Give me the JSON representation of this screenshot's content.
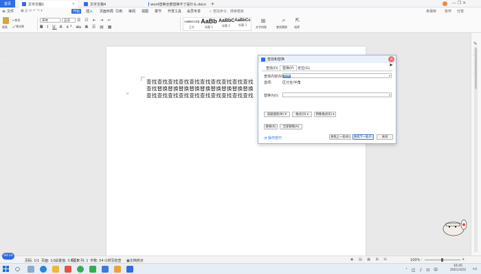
{
  "tabs": {
    "home": "首页",
    "items": [
      {
        "label": "文字文稿1",
        "color": "#2f6de1",
        "active": true
      },
      {
        "label": "文字文稿4",
        "color": "#2f6de1",
        "active": false
      },
      {
        "label": "word替换全部替换不了是什么.docx",
        "color": "#2f6de1",
        "active": false
      }
    ],
    "add": "+",
    "right": {
      "avatar": "A",
      "collab": "未保存",
      "share": "分享"
    }
  },
  "menu": {
    "file": "文件",
    "items": [
      "开始",
      "插入",
      "页面布局",
      "引用",
      "审阅",
      "视图",
      "章节",
      "开发工具",
      "会员专享"
    ],
    "active_index": 0,
    "search": "查找命令、搜索模板",
    "right": [
      "未保存",
      "协作",
      "分享"
    ]
  },
  "ribbon": {
    "paste": "粘贴",
    "cut": "剪切",
    "format_painter": "格式刷",
    "font_name": "宋体",
    "font_size": "五号",
    "styles": [
      {
        "preview": "AaBbCcDd",
        "label": "正文"
      },
      {
        "preview": "AaBb",
        "label": "标题 1"
      },
      {
        "preview": "AaBbC",
        "label": "标题 2"
      },
      {
        "preview": "AaBbCc",
        "label": "标题 3"
      }
    ],
    "text_tools": "文字排版",
    "find_replace": "查找替换",
    "select": "选择"
  },
  "document": {
    "lines": [
      "查找查找查找查找查找查找查找查找查找查找",
      "查找替换替换替换替换替换替换替换替换替换",
      "查找查找查找查找查找查找查找查找查找查找"
    ]
  },
  "dialog": {
    "title": "查找和替换",
    "close": "×",
    "tabs": [
      "查找(D)",
      "替换(P)",
      "定位(G)"
    ],
    "active_tab": 1,
    "find_label": "查找内容(N):",
    "find_value": "替换",
    "options_label": "选项:",
    "options_value": "区分全/半角",
    "replace_label": "替换为(I):",
    "replace_value": "",
    "advanced_btn": "高级搜索(M) ¥",
    "format_btn": "格式(O) ▾",
    "special_btn": "特殊格式(E) ▾",
    "replace_btn": "替换(R)",
    "replace_all_btn": "全部替换(A)",
    "tips": "操作技巧",
    "find_prev": "查找上一处(B)",
    "find_next": "查找下一处(F)",
    "close_btn": "关闭"
  },
  "status": {
    "page": "页码: 1/1",
    "page2": "页面: 1/1",
    "position": "设置值: 3.8厘米",
    "row": "行: 3",
    "col": "列: 1",
    "words": "字数: 54",
    "spell": "拼写检查",
    "proof": "文档校对",
    "zoom": "100%",
    "zoom_minus": "-",
    "zoom_plus": "+"
  },
  "taskbar": {
    "time": "16:45",
    "date": "2021/3/22",
    "badge": "00:14"
  },
  "colors": {
    "accent": "#2f6de1",
    "dialog_border": "#9fb7d8",
    "close_red": "#f26d6d"
  }
}
